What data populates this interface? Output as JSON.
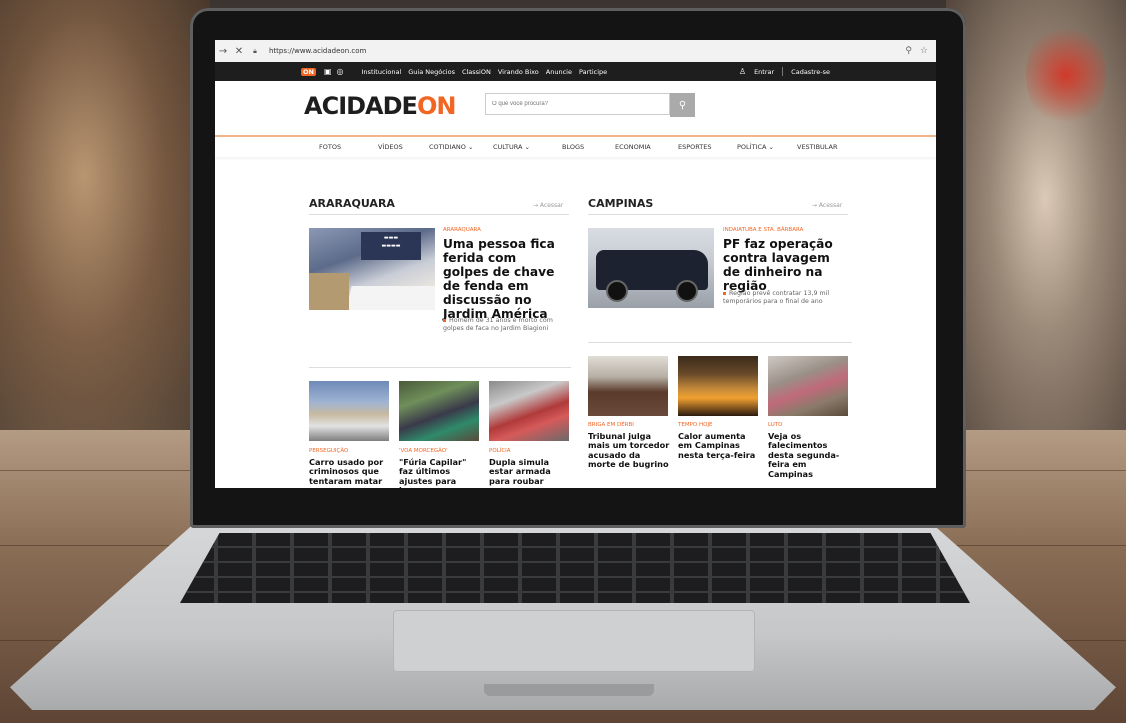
{
  "browser": {
    "back_icon": "arrow-right",
    "close_icon": "x",
    "url": "https://www.acidadeon.com"
  },
  "topbar": {
    "on_logo": "ON",
    "links": [
      "Institucional",
      "Guia Negócios",
      "ClassiON",
      "Virando Bixo",
      "Anuncie",
      "Participe"
    ],
    "login": "Entrar",
    "signup": "Cadastre-se"
  },
  "header": {
    "logo_main": "ACIDADE",
    "logo_on": "ON",
    "search_placeholder": "O que você procura?"
  },
  "nav": [
    "FOTOS",
    "VÍDEOS",
    "COTIDIANO ⌄",
    "CULTURA ⌄",
    "BLOGS",
    "ECONOMIA",
    "ESPORTES",
    "POLÍTICA ⌄",
    "VESTIBULAR"
  ],
  "araraquara": {
    "title": "ARARAQUARA",
    "link": "→ Acessar",
    "featured": {
      "category": "ARARAQUARA",
      "headline": "Uma pessoa fica ferida com golpes de chave de fenda em discussão no Jardim América",
      "related": "Homem de 31 anos é morto com golpes de faca no Jardim Biagioni"
    },
    "items": [
      {
        "category": "PERSEGUIÇÃO",
        "headline": "Carro usado por criminosos que tentaram matar"
      },
      {
        "category": "'VOA MORCEGÃO'",
        "headline": "\"Fúria Capilar\" faz últimos ajustes para levar"
      },
      {
        "category": "POLÍCIA",
        "headline": "Dupla simula estar armada para roubar"
      }
    ]
  },
  "campinas": {
    "title": "CAMPINAS",
    "link": "→ Acessar",
    "featured": {
      "category": "INDAIATUBA E STA. BÁRBARA",
      "headline": "PF faz operação contra lavagem de dinheiro na região",
      "related": "Região prevê contratar 13,9 mil temporários para o final de ano"
    },
    "items": [
      {
        "category": "BRIGA EM DÉRBI",
        "headline": "Tribunal julga mais um torcedor acusado da morte de bugrino"
      },
      {
        "category": "TEMPO HOJE",
        "headline": "Calor aumenta em Campinas nesta terça-feira"
      },
      {
        "category": "LUTO",
        "headline": "Veja os falecimentos desta segunda-feira em Campinas"
      }
    ]
  },
  "colors": {
    "accent": "#f26522",
    "topbar": "#1e1e1e"
  }
}
